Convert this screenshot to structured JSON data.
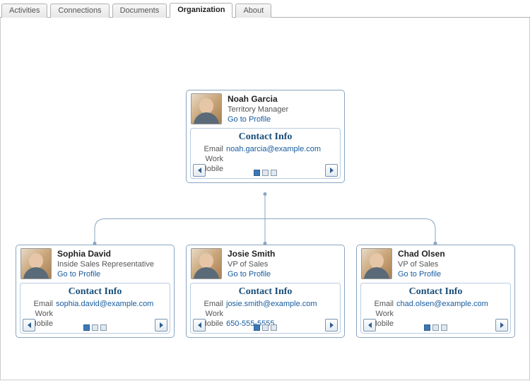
{
  "tabs": {
    "activities": "Activities",
    "connections": "Connections",
    "documents": "Documents",
    "organization": "Organization",
    "about": "About"
  },
  "labels": {
    "go_to_profile": "Go to Profile",
    "contact_info": "Contact Info",
    "email": "Email",
    "work": "Work",
    "mobile": "Mobile"
  },
  "people": {
    "root": {
      "name": "Noah Garcia",
      "title": "Territory Manager",
      "email": "noah.garcia@example.com",
      "work": "",
      "mobile": ""
    },
    "child1": {
      "name": "Sophia David",
      "title": "Inside Sales Representative",
      "email": "sophia.david@example.com",
      "work": "",
      "mobile": ""
    },
    "child2": {
      "name": "Josie Smith",
      "title": "VP of Sales",
      "email": "josie.smith@example.com",
      "work": "",
      "mobile": "650-555-5555"
    },
    "child3": {
      "name": "Chad Olsen",
      "title": "VP of Sales",
      "email": "chad.olsen@example.com",
      "work": "",
      "mobile": ""
    }
  }
}
